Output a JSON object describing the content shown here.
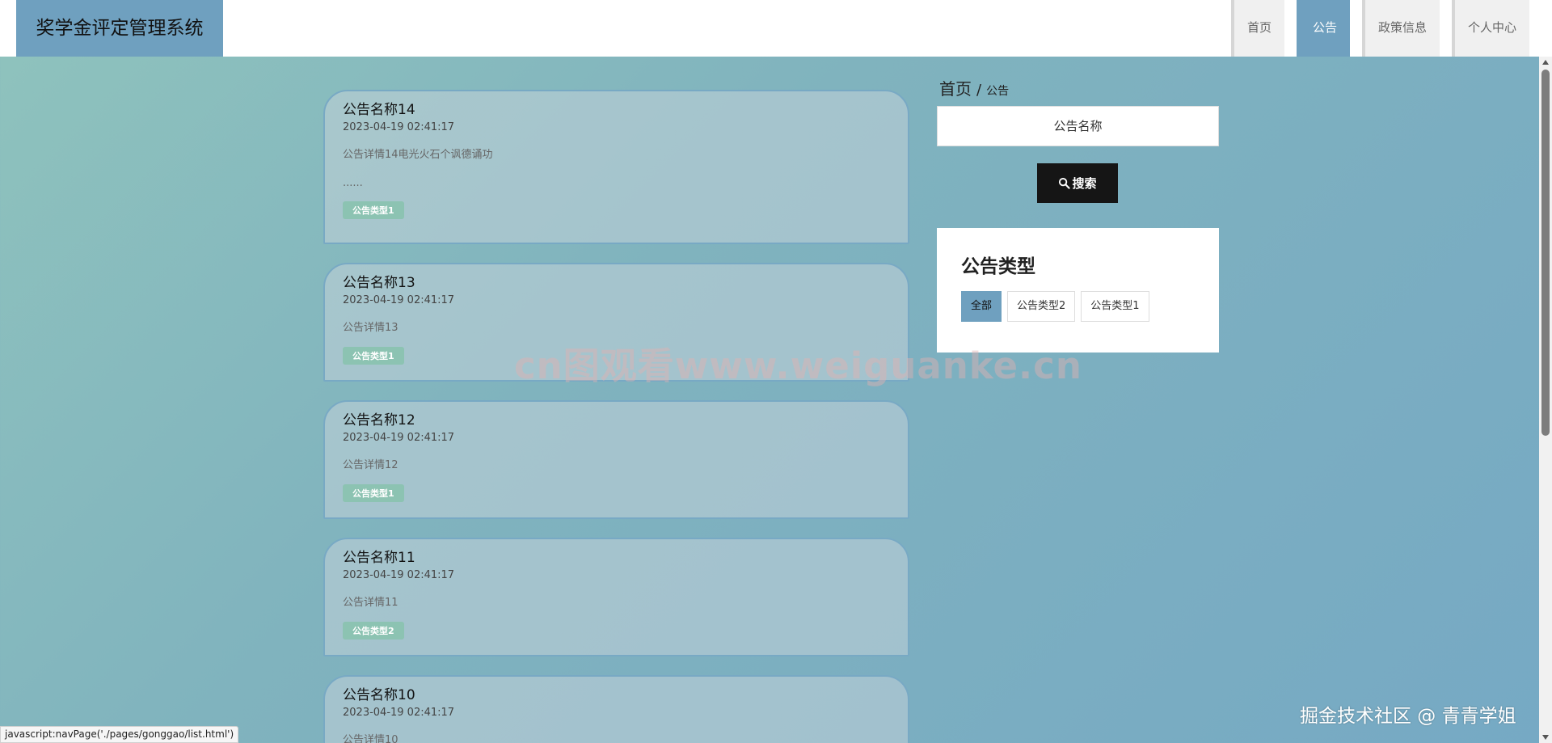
{
  "header": {
    "logo": "奖学金评定管理系统",
    "nav": [
      {
        "label": "首页"
      },
      {
        "label": "公告"
      },
      {
        "label": "政策信息"
      },
      {
        "label": "个人中心"
      }
    ]
  },
  "announcements": [
    {
      "title": "公告名称14",
      "time": "2023-04-19 02:41:17",
      "desc": "公告详情14电光火石个讽德诵功",
      "more": "......",
      "tag": "公告类型1"
    },
    {
      "title": "公告名称13",
      "time": "2023-04-19 02:41:17",
      "desc": "公告详情13",
      "tag": "公告类型1"
    },
    {
      "title": "公告名称12",
      "time": "2023-04-19 02:41:17",
      "desc": "公告详情12",
      "tag": "公告类型1"
    },
    {
      "title": "公告名称11",
      "time": "2023-04-19 02:41:17",
      "desc": "公告详情11",
      "tag": "公告类型2"
    },
    {
      "title": "公告名称10",
      "time": "2023-04-19 02:41:17",
      "desc": "公告详情10",
      "tag": ""
    }
  ],
  "breadcrumb": {
    "home": "首页",
    "separator": "/",
    "current": "公告"
  },
  "search": {
    "placeholder": "公告名称",
    "button": "搜索"
  },
  "types": {
    "title": "公告类型",
    "items": [
      {
        "label": "全部"
      },
      {
        "label": "公告类型2"
      },
      {
        "label": "公告类型1"
      }
    ]
  },
  "watermark": "cn图观看www.weiguanke.cn",
  "status_bar": "javascript:navPage('./pages/gonggao/list.html')",
  "credit": "掘金技术社区 @ 青青学姐",
  "colors": {
    "accent": "#6fa0bf",
    "tag": "#8cc3b2",
    "button": "#151515"
  }
}
